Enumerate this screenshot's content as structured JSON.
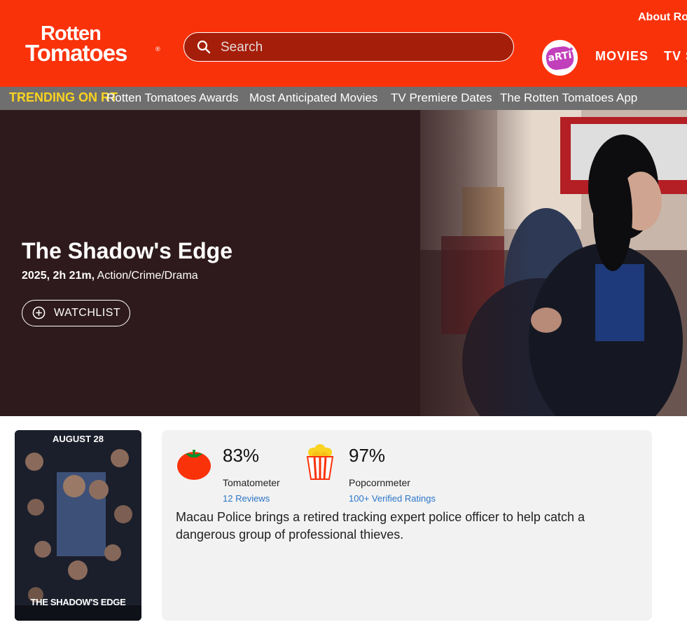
{
  "header": {
    "logo_line1": "Rotten",
    "logo_line2": "Tomatoes",
    "logo_reg": "®",
    "search_placeholder": "Search",
    "about_label": "About Ro",
    "arti_label": "aRTi",
    "nav": [
      "MOVIES",
      "TV S"
    ],
    "bg_color": "#fa320a"
  },
  "trending": {
    "label": "TRENDING ON RT",
    "items": [
      "Rotten Tomatoes Awards",
      "Most Anticipated Movies",
      "TV Premiere Dates",
      "The Rotten Tomatoes App"
    ]
  },
  "hero": {
    "title": "The Shadow's Edge",
    "meta_bold": "2025, 2h 21m,",
    "meta_genres": "Action/Crime/Drama",
    "watchlist_label": "WATCHLIST",
    "bg_color": "#2e1a1c"
  },
  "poster": {
    "top_text": "AUGUST 28",
    "bottom_text": "THE SHADOW'S EDGE"
  },
  "scores": {
    "tomatometer": {
      "value": "83%",
      "label": "Tomatometer",
      "link": "12 Reviews"
    },
    "popcornmeter": {
      "value": "97%",
      "label": "Popcornmeter",
      "link": "100+ Verified Ratings"
    }
  },
  "synopsis": "Macau Police brings a retired tracking expert police officer to help catch a dangerous group of professional thieves.",
  "icons": [
    "search-icon",
    "plus-circle-icon",
    "tomato-icon",
    "popcorn-icon"
  ]
}
